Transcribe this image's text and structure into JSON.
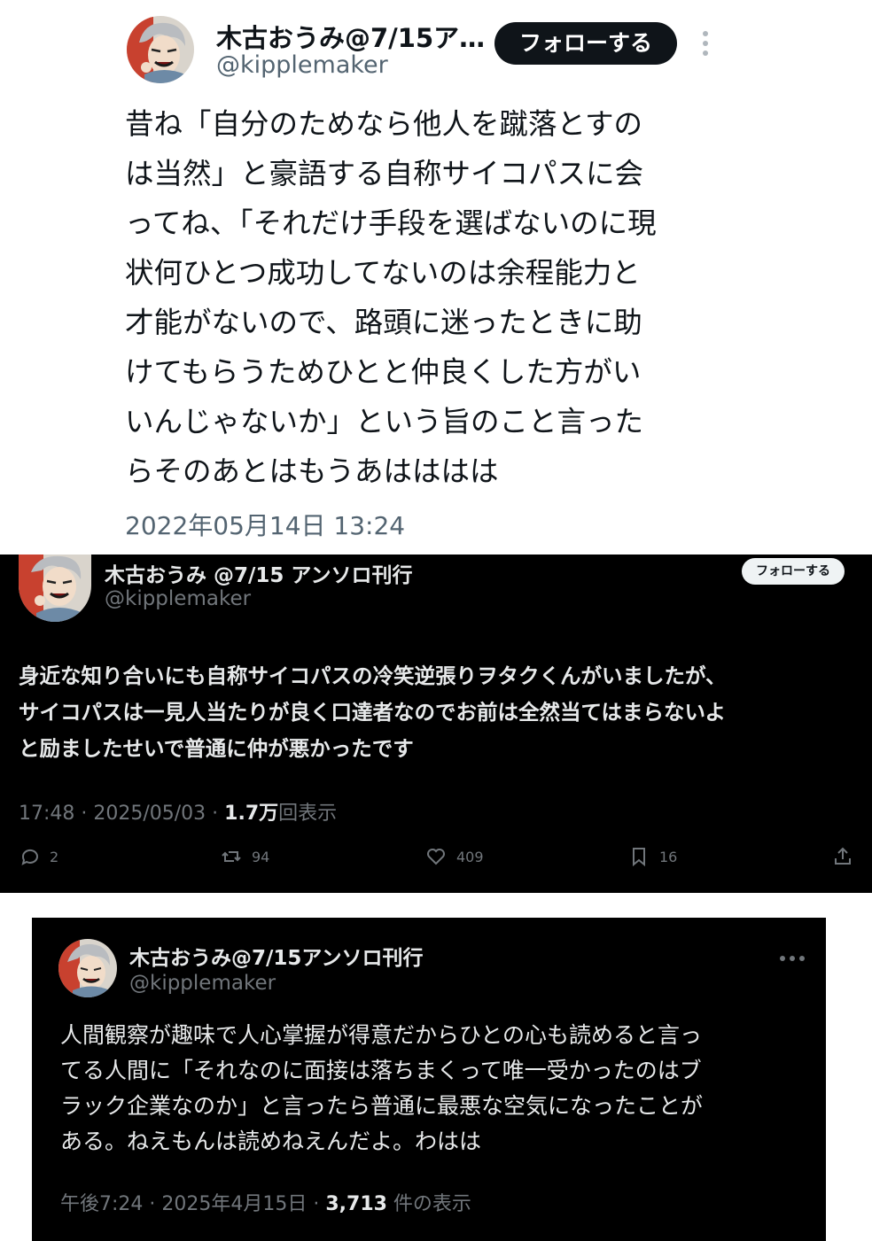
{
  "tweet1": {
    "display_name": "木古おうみ@7/15ア…",
    "handle": "@kipplemaker",
    "follow_label": "フォローする",
    "more_icon": "vertical-dots-icon",
    "text_lines": [
      "昔ね「自分のためなら他人を蹴落とすの",
      "は当然」と豪語する自称サイコパスに会",
      "ってね、「それだけ手段を選ばないのに現",
      "状何ひとつ成功してないのは余程能力と",
      "才能がないので、路頭に迷ったときに助",
      "けてもらうためひとと仲良くした方がい",
      "いんじゃないか」という旨のこと言った",
      "らそのあとはもうあはははは"
    ],
    "timestamp": "2022年05月14日 13:24"
  },
  "tweet2": {
    "display_name": "木古おうみ @7/15 アンソロ刊行",
    "handle": "@kipplemaker",
    "follow_label": "フォローする",
    "text_lines": [
      "身近な知り合いにも自称サイコパスの冷笑逆張りヲタクくんがいましたが、",
      "サイコパスは一見人当たりが良く口達者なのでお前は全然当てはまらないよ",
      "と励ましたせいで普通に仲が悪かったです"
    ],
    "time": "17:48 · 2025/05/03 · ",
    "views_count": "1.7万",
    "views_label": "回表示",
    "actions": {
      "replies": "2",
      "reposts": "94",
      "likes": "409",
      "bookmarks": "16"
    }
  },
  "tweet3": {
    "display_name": "木古おうみ@7/15アンソロ刊行",
    "handle": "@kipplemaker",
    "more_icon": "horizontal-dots-icon",
    "text_lines": [
      "人間観察が趣味で人心掌握が得意だからひとの心も読めると言っ",
      "てる人間に「それなのに面接は落ちまくって唯一受かったのはブ",
      "ラック企業なのか」と言ったら普通に最悪な空気になったことが",
      "ある。ねえもんは読めねえんだよ。わはは"
    ],
    "time": "午後7:24 · 2025年4月15日 · ",
    "views_count": "3,713",
    "views_label": " 件の表示"
  },
  "colors": {
    "light_text": "#0f1419",
    "light_secondary": "#536471",
    "dark_text": "#e7e9ea",
    "dark_secondary": "#71767b"
  }
}
